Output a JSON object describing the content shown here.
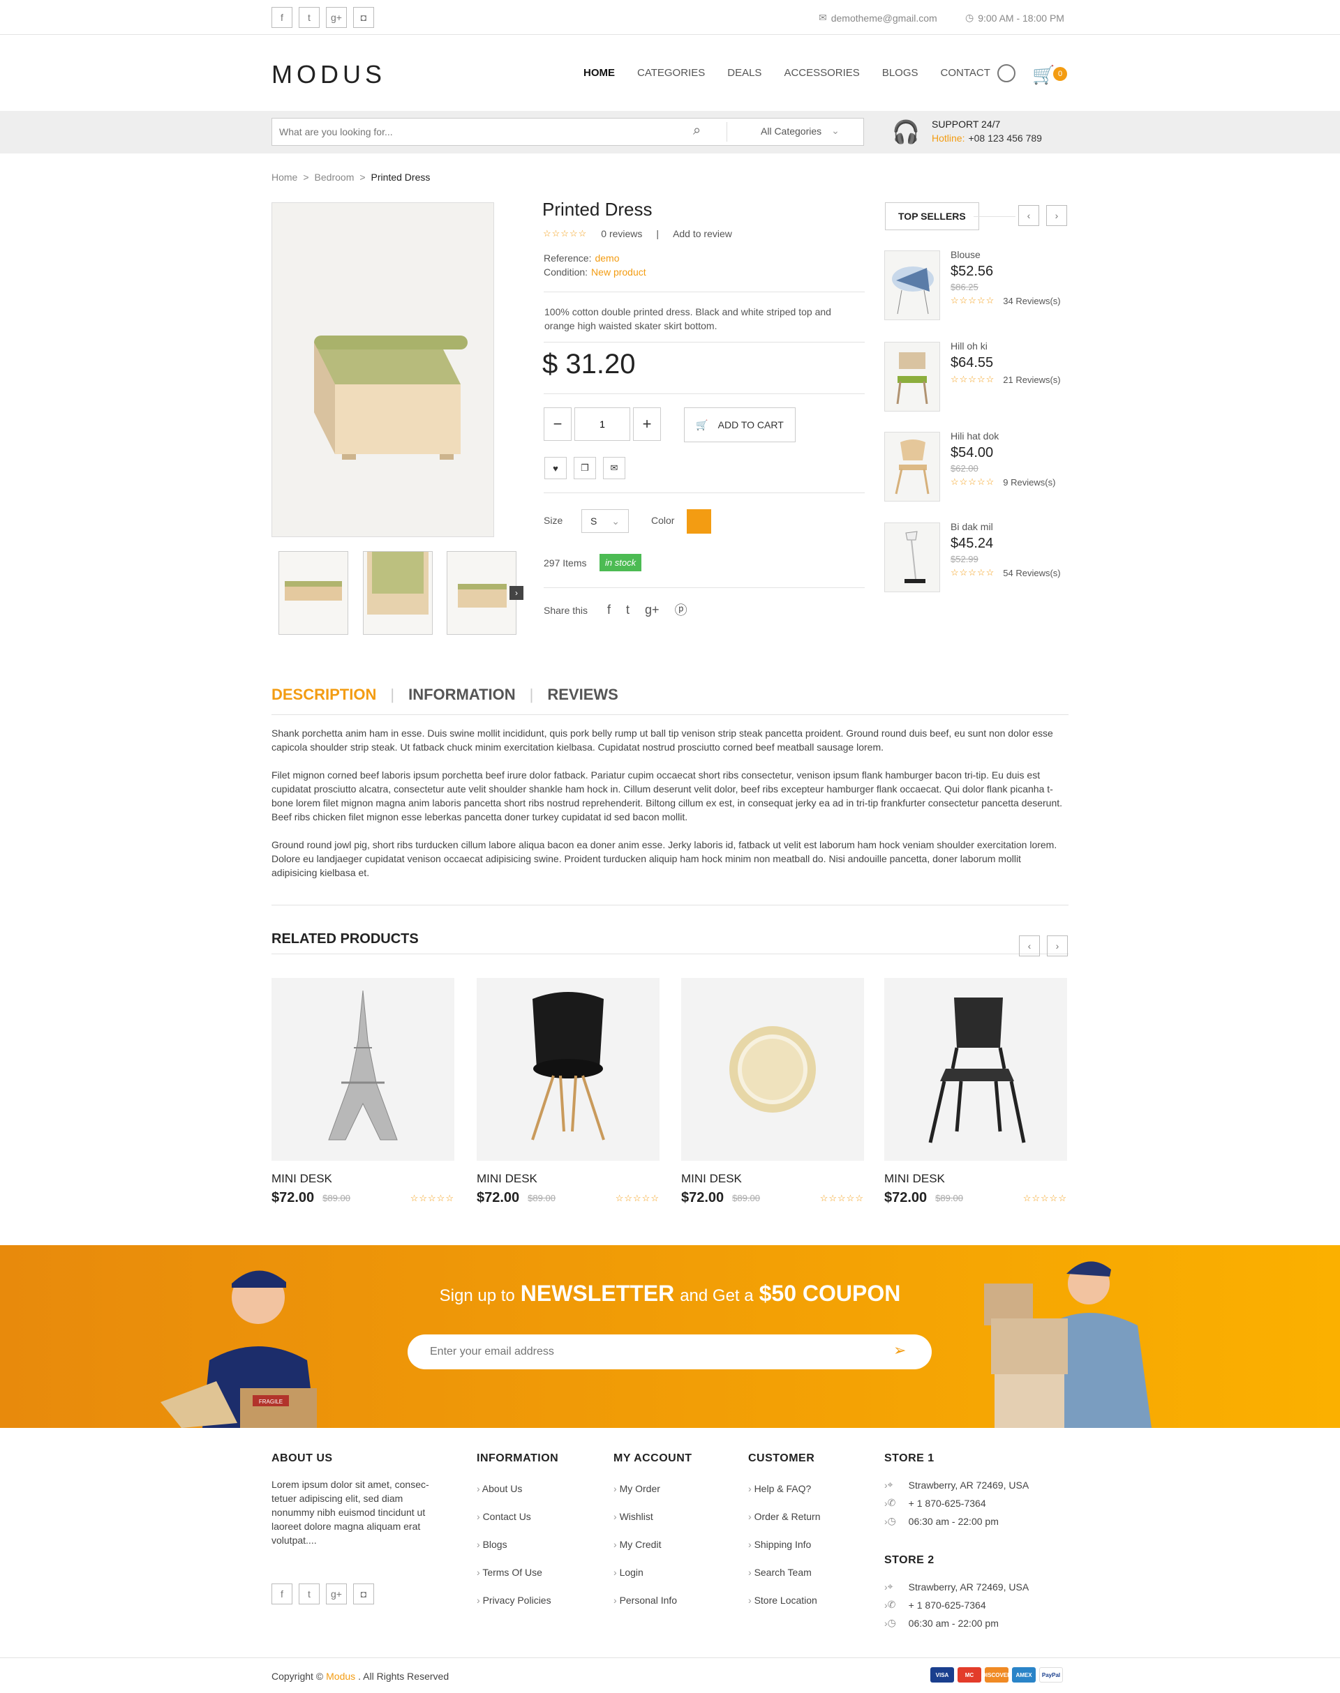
{
  "topbar": {
    "email": "demotheme@gmail.com",
    "hours": "9:00 AM - 18:00 PM"
  },
  "header": {
    "logo": "MODUS",
    "nav": [
      "HOME",
      "CATEGORIES",
      "DEALS",
      "ACCESSORIES",
      "BLOGS",
      "CONTACT"
    ],
    "cart_count": "0"
  },
  "search": {
    "placeholder": "What are you looking for...",
    "category": "All Categories"
  },
  "support": {
    "title": "SUPPORT 24/7",
    "hotline_label": "Hotline:",
    "hotline": "+08 123 456 789"
  },
  "breadcrumb": [
    "Home",
    "Bedroom",
    "Printed Dress"
  ],
  "product": {
    "title": "Printed Dress",
    "reviews": "0 reviews",
    "add_review": "Add to review",
    "reference_label": "Reference:",
    "reference": "demo",
    "condition_label": "Condition:",
    "condition": "New product",
    "description_line1": "100% cotton double printed dress. Black and white striped top and",
    "description_line2": "orange high waisted skater skirt bottom.",
    "price": "$ 31.20",
    "qty": "1",
    "add_to_cart": "ADD TO CART",
    "size_label": "Size",
    "size": "S",
    "color_label": "Color",
    "color": "#f39c12",
    "items": "297 Items",
    "stock": "in stock",
    "share_label": "Share this"
  },
  "top_sellers": {
    "title": "TOP SELLERS",
    "items": [
      {
        "name": "Blouse",
        "price": "$52.56",
        "old_price": "$86.25",
        "reviews": "34 Reviews(s)"
      },
      {
        "name": "Hill oh ki",
        "price": "$64.55",
        "old_price": "",
        "reviews": "21 Reviews(s)"
      },
      {
        "name": "Hili hat dok",
        "price": "$54.00",
        "old_price": "$62.00",
        "reviews": "9 Reviews(s)"
      },
      {
        "name": "Bi dak mil",
        "price": "$45.24",
        "old_price": "$52.99",
        "reviews": "54 Reviews(s)"
      }
    ]
  },
  "tabs": [
    "DESCRIPTION",
    "INFORMATION",
    "REVIEWS"
  ],
  "description": [
    "Shank porchetta anim ham in esse. Duis swine mollit incididunt, quis pork belly rump ut ball tip venison strip steak pancetta proident. Ground round duis beef, eu sunt non dolor esse capicola shoulder strip steak. Ut fatback chuck minim exercitation kielbasa. Cupidatat nostrud prosciutto corned beef meatball sausage lorem.",
    "Filet mignon corned beef laboris ipsum porchetta beef irure dolor fatback. Pariatur cupim occaecat short ribs consectetur, venison ipsum flank hamburger bacon tri-tip. Eu duis est cupidatat prosciutto alcatra, consectetur aute velit shoulder shankle ham hock in. Cillum deserunt velit dolor, beef ribs excepteur hamburger flank occaecat. Qui dolor flank picanha t-bone lorem filet mignon magna anim laboris pancetta short ribs nostrud reprehenderit. Biltong cillum ex est, in consequat jerky ea ad in tri-tip frankfurter consectetur pancetta deserunt. Beef ribs chicken filet mignon esse leberkas pancetta doner turkey cupidatat id sed bacon mollit.",
    "Ground round jowl pig, short ribs turducken cillum labore aliqua bacon ea doner anim esse. Jerky laboris id, fatback ut velit est laborum ham hock veniam shoulder exercitation lorem. Dolore eu landjaeger cupidatat venison occaecat adipisicing swine. Proident turducken aliquip ham hock minim non meatball do. Nisi andouille pancetta, doner laborum mollit adipisicing kielbasa et."
  ],
  "related": {
    "title": "RELATED PRODUCTS",
    "items": [
      {
        "name": "MINI DESK",
        "price": "$72.00",
        "old_price": "$89.00"
      },
      {
        "name": "MINI DESK",
        "price": "$72.00",
        "old_price": "$89.00"
      },
      {
        "name": "MINI DESK",
        "price": "$72.00",
        "old_price": "$89.00"
      },
      {
        "name": "MINI DESK",
        "price": "$72.00",
        "old_price": "$89.00"
      }
    ]
  },
  "newsletter": {
    "pre": "Sign up to",
    "highlight": "NEWSLETTER",
    "mid": "and Get a",
    "coupon": "$50 COUPON",
    "placeholder": "Enter your email address",
    "box_label": "FRAGILE"
  },
  "footer": {
    "about_title": "ABOUT US",
    "about_text": "Lorem ipsum dolor sit amet, consec-tetuer adipiscing elit, sed diam nonummy nibh euismod tincidunt ut laoreet dolore magna aliquam erat volutpat....",
    "columns": [
      {
        "title": "INFORMATION",
        "links": [
          "About Us",
          "Contact Us",
          "Blogs",
          "Terms Of Use",
          "Privacy Policies"
        ]
      },
      {
        "title": "MY ACCOUNT",
        "links": [
          "My Order",
          "Wishlist",
          "My Credit",
          "Login",
          "Personal Info"
        ]
      },
      {
        "title": "CUSTOMER",
        "links": [
          "Help & FAQ?",
          "Order & Return",
          "Shipping Info",
          "Search Team",
          "Store Location"
        ]
      }
    ],
    "stores": [
      {
        "title": "STORE 1",
        "address": "Strawberry, AR 72469, USA",
        "phone": "+ 1 870-625-7364",
        "hours": "06:30 am - 22:00 pm"
      },
      {
        "title": "STORE 2",
        "address": "Strawberry, AR 72469, USA",
        "phone": "+ 1 870-625-7364",
        "hours": "06:30 am - 22:00 pm"
      }
    ],
    "copyright_pre": "Copyright ©",
    "copyright_brand": "Modus",
    "copyright_post": ". All Rights Reserved",
    "payments": [
      "VISA",
      "MC",
      "DISCOVER",
      "AMEX",
      "PayPal"
    ]
  }
}
